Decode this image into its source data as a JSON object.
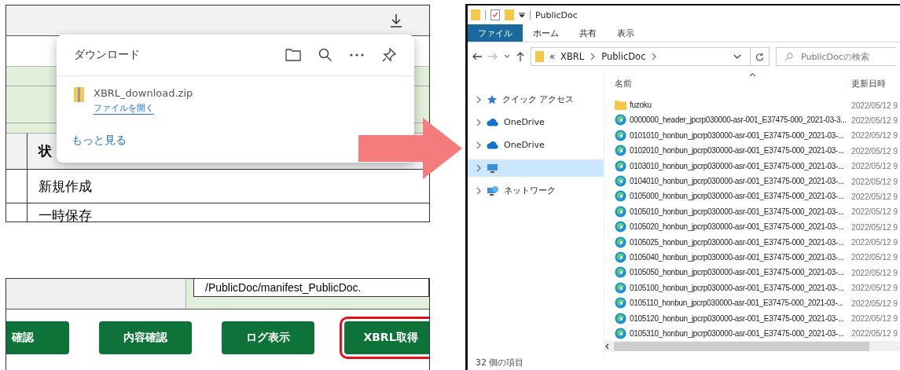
{
  "browser_panel": {
    "download_popup": {
      "title": "ダウンロード",
      "file": {
        "name": "XBRL_download.zip",
        "action": "ファイルを開く"
      },
      "more_link": "もっと見る"
    },
    "table": {
      "header": "状",
      "rows": [
        "新規作成",
        "一時保存"
      ]
    }
  },
  "form_panel": {
    "path_field": {
      "value": "/PublicDoc/manifest_PublicDoc."
    },
    "buttons": [
      {
        "label": "確認",
        "highlighted": false
      },
      {
        "label": "内容確認",
        "highlighted": false
      },
      {
        "label": "ログ表示",
        "highlighted": false
      },
      {
        "label": "XBRL取得",
        "highlighted": true
      }
    ]
  },
  "explorer": {
    "title": "PublicDoc",
    "ribbon_tabs": [
      {
        "label": "ファイル",
        "selected": true
      },
      {
        "label": "ホーム",
        "selected": false
      },
      {
        "label": "共有",
        "selected": false
      },
      {
        "label": "表示",
        "selected": false
      }
    ],
    "address": {
      "overflow_mark": "«",
      "crumbs": [
        "XBRL",
        "PublicDoc"
      ]
    },
    "search": {
      "placeholder": "PublicDocの検索"
    },
    "nav_items": [
      {
        "label": "クイック アクセス",
        "kind": "star",
        "selected": false
      },
      {
        "label": "OneDrive",
        "kind": "cloud",
        "selected": false
      },
      {
        "label": "OneDrive",
        "kind": "cloud",
        "selected": false
      },
      {
        "kind": "pc",
        "selected": true
      },
      {
        "label": "ネットワーク",
        "kind": "network",
        "selected": false
      }
    ],
    "columns": [
      "名前",
      "更新日時"
    ],
    "files": [
      {
        "name": "fuzoku",
        "kind": "folder",
        "modified": "2022/05/12 9"
      },
      {
        "name": "0000000_header_jpcrp030000-asr-001_E37475-000_2021-03-3...",
        "kind": "edge",
        "modified": "2022/05/12 9"
      },
      {
        "name": "0101010_honbun_jpcrp030000-asr-001_E37475-000_2021-03-...",
        "kind": "edge",
        "modified": "2022/05/12 9"
      },
      {
        "name": "0102010_honbun_jpcrp030000-asr-001_E37475-000_2021-03-...",
        "kind": "edge",
        "modified": "2022/05/12 9"
      },
      {
        "name": "0103010_honbun_jpcrp030000-asr-001_E37475-000_2021-03-...",
        "kind": "edge",
        "modified": "2022/05/12 9"
      },
      {
        "name": "0104010_honbun_jpcrp030000-asr-001_E37475-000_2021-03-...",
        "kind": "edge",
        "modified": "2022/05/12 9"
      },
      {
        "name": "0105000_honbun_jpcrp030000-asr-001_E37475-000_2021-03-...",
        "kind": "edge",
        "modified": "2022/05/12 9"
      },
      {
        "name": "0105010_honbun_jpcrp030000-asr-001_E37475-000_2021-03-...",
        "kind": "edge",
        "modified": "2022/05/12 9"
      },
      {
        "name": "0105020_honbun_jpcrp030000-asr-001_E37475-000_2021-03-...",
        "kind": "edge",
        "modified": "2022/05/12 9"
      },
      {
        "name": "0105025_honbun_jpcrp030000-asr-001_E37475-000_2021-03-...",
        "kind": "edge",
        "modified": "2022/05/12 9"
      },
      {
        "name": "0105040_honbun_jpcrp030000-asr-001_E37475-000_2021-03-...",
        "kind": "edge",
        "modified": "2022/05/12 9"
      },
      {
        "name": "0105050_honbun_jpcrp030000-asr-001_E37475-000_2021-03-...",
        "kind": "edge",
        "modified": "2022/05/12 9"
      },
      {
        "name": "0105100_honbun_jpcrp030000-asr-001_E37475-000_2021-03-...",
        "kind": "edge",
        "modified": "2022/05/12 9"
      },
      {
        "name": "0105110_honbun_jpcrp030000-asr-001_E37475-000_2021-03-...",
        "kind": "edge",
        "modified": "2022/05/12 9"
      },
      {
        "name": "0105120_honbun_jpcrp030000-asr-001_E37475-000_2021-03-...",
        "kind": "edge",
        "modified": "2022/05/12 9"
      },
      {
        "name": "0105310_honbun_jpcrp030000-asr-001_E37475-000_2021-03-...",
        "kind": "edge",
        "modified": "2022/05/12 9"
      }
    ],
    "status": "32 個の項目"
  }
}
